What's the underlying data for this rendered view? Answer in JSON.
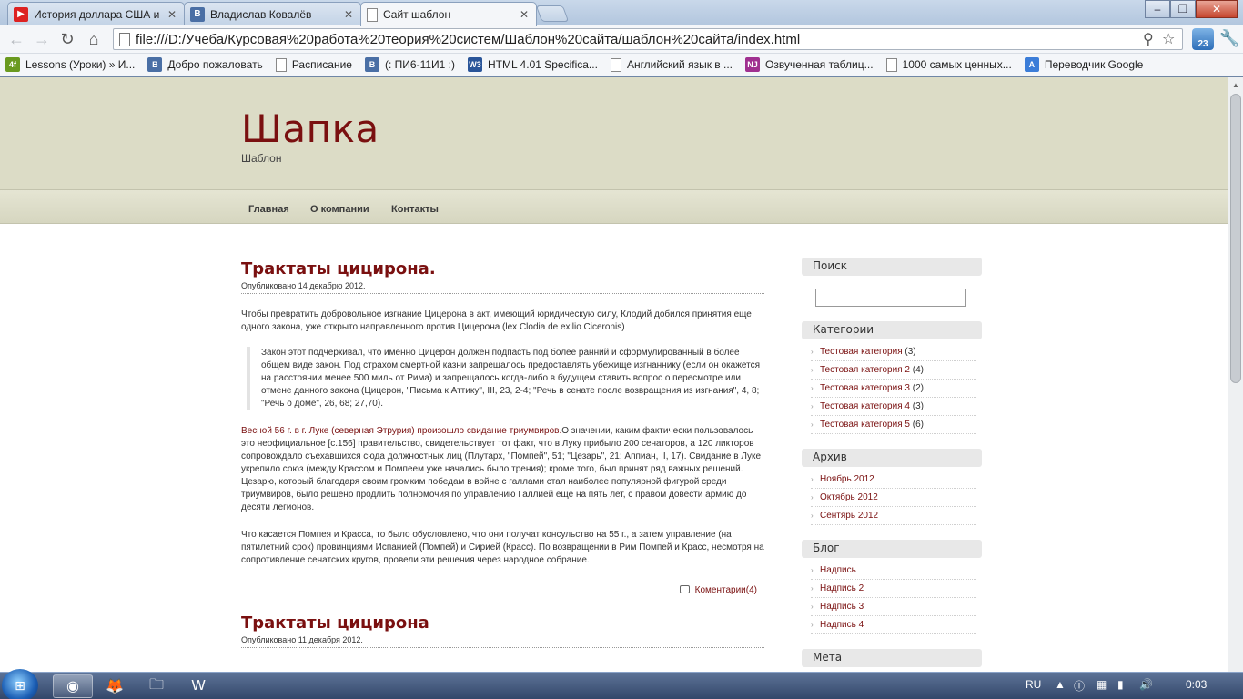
{
  "browser": {
    "tabs": [
      {
        "title": "История доллара США и",
        "favicon": "youtube-icon",
        "color": "#d22"
      },
      {
        "title": "Владислав Ковалёв",
        "favicon": "vk-icon",
        "color": "#4a6fa5"
      },
      {
        "title": "Сайт шаблон",
        "favicon": "page-icon",
        "color": "#ffffff",
        "active": true
      }
    ],
    "url": "file:///D:/Учеба/Курсовая%20работа%20теория%20систем/Шаблон%20сайта/шаблон%20сайта/index.html",
    "ext_badge": "23",
    "bookmarks": [
      {
        "label": "Lessons (Уроки) » И...",
        "icon": "4f-icon",
        "icon_text": "4f",
        "color": "#6a9a1f"
      },
      {
        "label": "Добро пожаловать",
        "icon": "vk-icon",
        "icon_text": "B",
        "color": "#4a6fa5"
      },
      {
        "label": "Расписание",
        "icon": "page-icon",
        "icon_text": "",
        "color": "#ffffff"
      },
      {
        "label": "(: ПИ6-11И1 :)",
        "icon": "vk-icon",
        "icon_text": "B",
        "color": "#4a6fa5"
      },
      {
        "label": "HTML 4.01 Specifica...",
        "icon": "w3-icon",
        "icon_text": "W3",
        "color": "#2a5599"
      },
      {
        "label": "Английский язык в ...",
        "icon": "page-icon",
        "icon_text": "",
        "color": "#ffffff"
      },
      {
        "label": "Озвученная таблиц...",
        "icon": "njnj-icon",
        "icon_text": "NJ",
        "color": "#a03090"
      },
      {
        "label": "1000 самых ценных...",
        "icon": "page-icon",
        "icon_text": "",
        "color": "#ffffff"
      },
      {
        "label": "Переводчик Google",
        "icon": "translate-icon",
        "icon_text": "A",
        "color": "#3b7dd8"
      }
    ]
  },
  "site": {
    "title": "Шапка",
    "subtitle": "Шаблон",
    "nav": [
      "Главная",
      "О компании",
      "Контакты"
    ],
    "accent_color": "#7a1010"
  },
  "posts": [
    {
      "title": "Трактаты цицирона.",
      "meta": "Опубликовано 14 декабрю 2012.",
      "p1": "Чтобы превратить добровольное изгнание Цицерона в акт, имеющий юридическую силу, Клодий добился принятия еще одного закона, уже открыто направленного против Цицерона (lex Clodia de exilio Ciceronis)",
      "quote": "Закон этот подчеркивал, что именно Цицерон должен подпасть под более ранний и сформулированный в более общем виде закон. Под страхом смертной казни запрещалось предоставлять убежище изгнаннику (если он окажется на расстоянии менее 500 миль от Рима) и запрещалось когда-либо в будущем ставить вопрос о пересмотре или отмене данного закона (Цицерон, \"Письма к Аттику\", III, 23, 2-4; \"Речь в сенате после возвращения из изгнания\", 4, 8; \"Речь о доме\", 26, 68; 27,70).",
      "p2_link": "Весной 56 г. в г. Луке (северная Этрурия) произошло свидание триумвиров.",
      "p2_rest": "О значении, каким фактически пользовалось это неофициальное [с.156] правительство, свидетельствует тот факт, что в Луку прибыло 200 сенаторов, а 120 ликторов сопровождало съехавшихся сюда должностных лиц (Плутарх, \"Помпей\", 51; \"Цезарь\", 21; Аппиан, II, 17). Свидание в Луке укрепило союз (между Крассом и Помпеем уже начались было трения); кроме того, был принят ряд важных решений. Цезарю, который благодаря своим громким победам в войне с галлами стал наиболее популярной фигурой среди триумвиров, было решено продлить полномочия по управлению Галлией еще на пять лет, с правом довести армию до десяти легионов.",
      "p3": "Что касается Помпея и Красса, то было обусловлено, что они получат консульство на 55 г., а затем управление (на пятилетний срок) провинциями Испанией (Помпей) и Сирией (Красс). По возвращении в Рим Помпей и Красс, несмотря на сопротивление сенатских кругов, провели эти решения через народное собрание.",
      "comments": "Коментарии(4)"
    },
    {
      "title": "Трактаты цицирона",
      "meta": "Опубликовано 11 декабря 2012."
    }
  ],
  "sidebar": {
    "search_title": "Поиск",
    "categories_title": "Категории",
    "categories": [
      {
        "name": "Тестовая категория",
        "count": "(3)"
      },
      {
        "name": "Тестовая категория 2",
        "count": "(4)"
      },
      {
        "name": "Тестовая категория 3",
        "count": "(2)"
      },
      {
        "name": "Тестовая категория 4",
        "count": "(3)"
      },
      {
        "name": "Тестовая категория 5",
        "count": "(6)"
      }
    ],
    "archive_title": "Архив",
    "archive": [
      "Ноябрь 2012",
      "Октябрь 2012",
      "Сентярь 2012"
    ],
    "blog_title": "Блог",
    "blog": [
      "Надпись",
      "Надпись 2",
      "Надпись 3",
      "Надпись 4"
    ],
    "meta_title": "Мета"
  },
  "taskbar": {
    "lang": "RU",
    "time": "0:03"
  }
}
